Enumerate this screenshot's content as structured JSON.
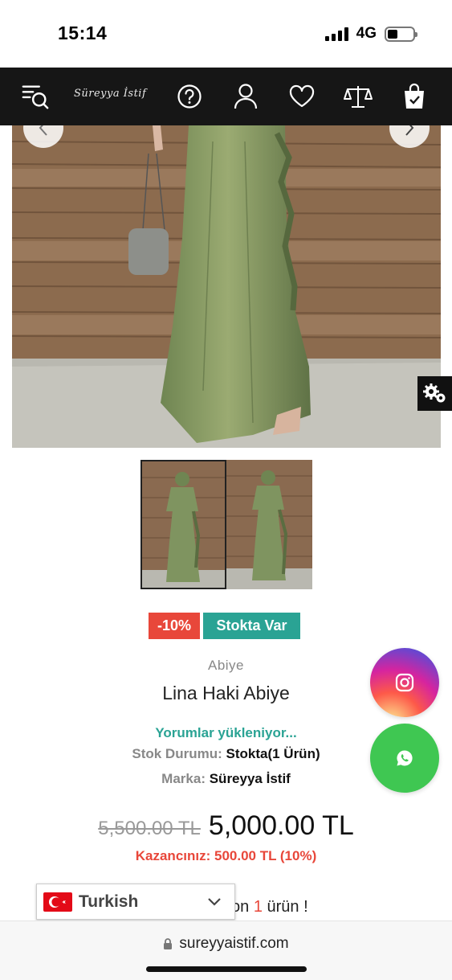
{
  "status_bar": {
    "time": "15:14",
    "network": "4G"
  },
  "header": {
    "logo_text": "Süreyya İstif",
    "icons": [
      "menu-search-icon",
      "help-icon",
      "user-icon",
      "heart-icon",
      "compare-scale-icon",
      "shopping-bag-icon"
    ]
  },
  "product": {
    "discount_badge": "-10%",
    "stock_badge": "Stokta Var",
    "category": "Abiye",
    "name": "Lina Haki Abiye",
    "reviews_text": "Yorumlar yükleniyor...",
    "stock_label": "Stok Durumu:",
    "stock_value": "Stokta(1 Ürün)",
    "brand_label": "Marka:",
    "brand_value": "Süreyya İstif",
    "old_price": "5,500.00 TL",
    "new_price": "5,000.00 TL",
    "saving_text": "Kazancınız: 500.00 TL (10%)",
    "stock_note_prefix": "on",
    "stock_note_count": "1",
    "stock_note_suffix": "ürün !"
  },
  "language": {
    "selected": "Turkish"
  },
  "browser": {
    "url": "sureyyaistif.com"
  },
  "colors": {
    "header_bg": "#161616",
    "accent_teal": "#2aa394",
    "accent_red": "#e8473a",
    "dress_green": "#7f9460"
  }
}
